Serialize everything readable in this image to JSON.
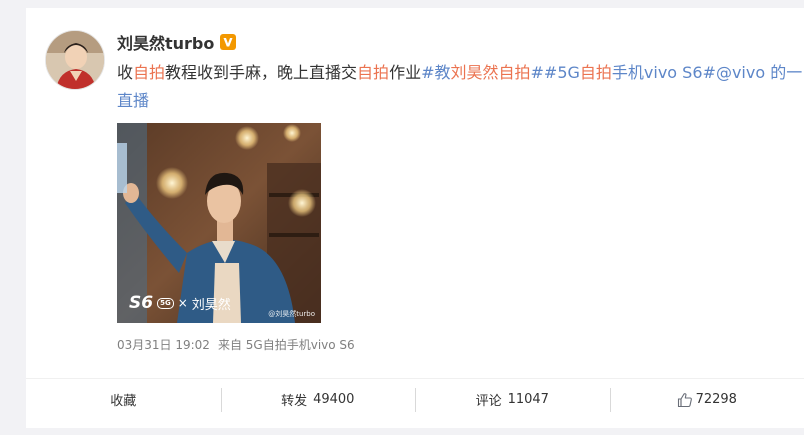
{
  "post": {
    "author": "刘昊然turbo",
    "verified_badge": "vip-v-icon",
    "text_segments": [
      {
        "t": "收",
        "k": "plain"
      },
      {
        "t": "自拍",
        "k": "hl"
      },
      {
        "t": "教程收到手麻，晚上直播交",
        "k": "plain"
      },
      {
        "t": "自拍",
        "k": "hl"
      },
      {
        "t": "作业",
        "k": "plain"
      },
      {
        "t": "#教",
        "k": "link"
      },
      {
        "t": "刘昊然自拍",
        "k": "hl"
      },
      {
        "t": "##5G",
        "k": "link"
      },
      {
        "t": "自拍",
        "k": "hl"
      },
      {
        "t": "手机vivo S6#",
        "k": "link"
      },
      {
        "t": "@vivo 的一直播",
        "k": "link"
      }
    ],
    "image": {
      "brand_model": "S6",
      "brand_chip": "5G",
      "brand_x": "×",
      "brand_name": "刘昊然",
      "watermark": "@刘昊然turbo"
    },
    "timestamp": "03月31日 19:02",
    "source_prefix": "来自",
    "source": "5G自拍手机vivo S6"
  },
  "actions": {
    "favorite_label": "收藏",
    "repost_label": "转发",
    "repost_count": "49400",
    "comment_label": "评论",
    "comment_count": "11047",
    "like_count": "72298"
  },
  "colors": {
    "highlight": "#eb7350",
    "link": "#5d86c8",
    "meta": "#808080",
    "badge": "#f39800"
  }
}
